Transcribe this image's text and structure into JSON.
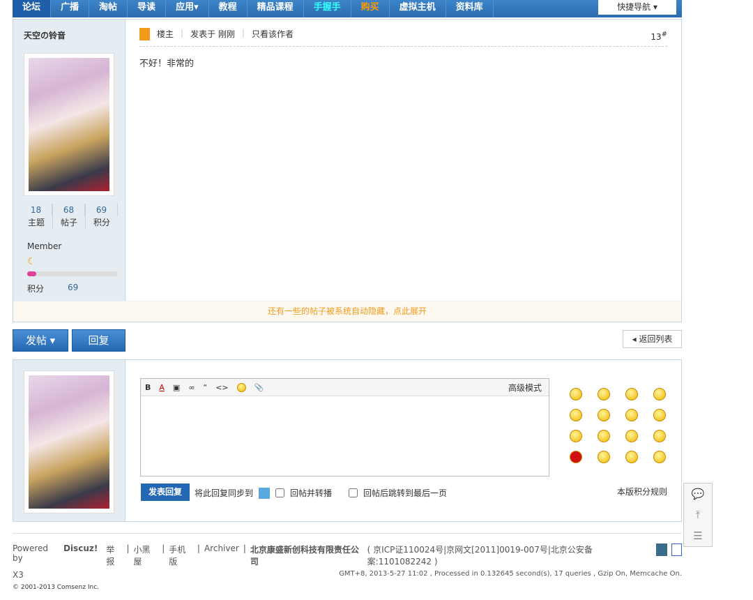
{
  "nav": {
    "items": [
      "论坛",
      "广播",
      "淘帖",
      "导读",
      "应用▾",
      "教程",
      "精品课程",
      "手握手",
      "购买",
      "虚拟主机",
      "资料库"
    ],
    "quick": "快捷导航 ▾"
  },
  "post": {
    "author": "天空の铃音",
    "role": "楼主",
    "posted": "发表于 刚刚",
    "only_author": "只看该作者",
    "floor": "13",
    "floor_sym": "#",
    "content": "不好！非常的",
    "stats": [
      {
        "n": "18",
        "l": "主题"
      },
      {
        "n": "68",
        "l": "帖子"
      },
      {
        "n": "69",
        "l": "积分"
      }
    ],
    "group": "Member",
    "credit_label": "积分",
    "credit": "69",
    "level_progress": 0.1
  },
  "hidden_notice": "还有一些的帖子被系统自动隐藏，点此展开",
  "actions": {
    "newpost": "发帖",
    "reply": "回复",
    "back": "◂ 返回列表"
  },
  "editor": {
    "advanced": "高级模式",
    "submit": "发表回复",
    "sync": "将此回复同步到",
    "forward": "回帖并转播",
    "jump": "回帖后跳转到最后一页",
    "rules": "本版积分规则"
  },
  "footer": {
    "powered": "Powered by",
    "brand": "Discuz!",
    "ver": "X3",
    "links": [
      "举报",
      "小黑屋",
      "手机版",
      "Archiver"
    ],
    "company": "北京康盛新创科技有限责任公司",
    "icp": "( 京ICP证110024号|京网文[2011]0019-007号|北京公安备案:1101082242 )",
    "stats": "GMT+8, 2013-5-27 11:02 , Processed in 0.132645 second(s), 17 queries , Gzip On, Memcache On.",
    "copy": "© 2001-2013 Comsenz Inc."
  }
}
